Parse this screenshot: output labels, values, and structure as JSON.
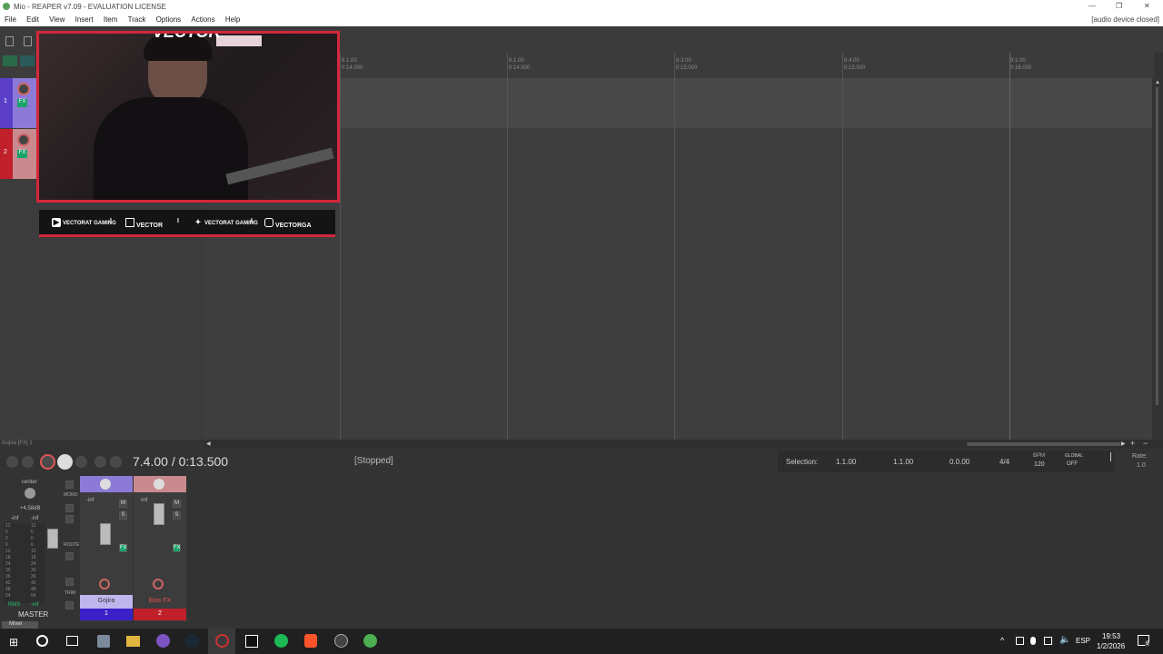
{
  "window": {
    "title": "Mio - REAPER v7.09 - EVALUATION LICENSE",
    "audio_status": "[audio device closed]",
    "controls": [
      "—",
      "❐",
      "✕"
    ]
  },
  "menu": [
    "File",
    "Edit",
    "View",
    "Insert",
    "Item",
    "Track",
    "Options",
    "Actions",
    "Help"
  ],
  "overlay": {
    "logo_text": "VECTOR",
    "socials": [
      {
        "icon": "youtube-icon",
        "label": "VECTORAT GAMING"
      },
      {
        "icon": "twitch-icon",
        "label": "VECTOR"
      },
      {
        "icon": "twitter-icon",
        "label": "VECTORAT GAMING"
      },
      {
        "icon": "instagram-icon",
        "label": "VECTORGA"
      }
    ],
    "separator": "I"
  },
  "tracks": [
    {
      "number": "1",
      "color": "#5a3ec8",
      "fx": "FX"
    },
    {
      "number": "2",
      "color": "#c0202a",
      "fx": "FX"
    }
  ],
  "ruler": [
    {
      "bar": "8.1.00",
      "time": "0:14.000"
    },
    {
      "bar": "8.1.00",
      "time": "0:14.500"
    },
    {
      "bar": "8.3.00",
      "time": "0:15.000"
    },
    {
      "bar": "8.4.00",
      "time": "0:15.500"
    },
    {
      "bar": "9.1.00",
      "time": "0:16.000"
    }
  ],
  "status_left": "Gojira [FX] 1",
  "transport": {
    "position": "7.4.00 / 0:13.500",
    "state": "[Stopped]",
    "selection_label": "Selection:",
    "sel_start": "1.1.00",
    "sel_end": "1.1.00",
    "sel_len": "0.0.00",
    "time_sig": "4/4",
    "bpm_label": "BPM",
    "bpm": "120",
    "global_label": "GLOBAL",
    "global_state": "OFF",
    "rate_label": "Rate:",
    "rate": "1.0"
  },
  "mixer": {
    "master": {
      "pan": "center",
      "gain": "+4.58dB",
      "left_peak": "-inf",
      "right_peak": "-inf",
      "rms_label": "RMS",
      "rms_value": "-inf",
      "label": "MASTER",
      "mono_label": "MONO",
      "route_label": "ROUTE",
      "trim_label": "TRIM",
      "scale": [
        "12",
        "6",
        "0",
        "6",
        "12",
        "18",
        "24",
        "30",
        "36",
        "42",
        "48",
        "54"
      ]
    },
    "strips": [
      {
        "name": "Gojira",
        "number": "1",
        "color": "#5a3ec8",
        "peak": "-inf",
        "m": "M",
        "s": "S",
        "fx": "FX"
      },
      {
        "name": "Bias FX",
        "number": "2",
        "color": "#c0202a",
        "peak": "-inf",
        "m": "M",
        "s": "S",
        "fx": "FX"
      }
    ],
    "tab_label": "Mixer"
  },
  "taskbar": {
    "time": "19:53",
    "date": "1/2/2026",
    "lang": "ESP",
    "notifications": "9"
  }
}
